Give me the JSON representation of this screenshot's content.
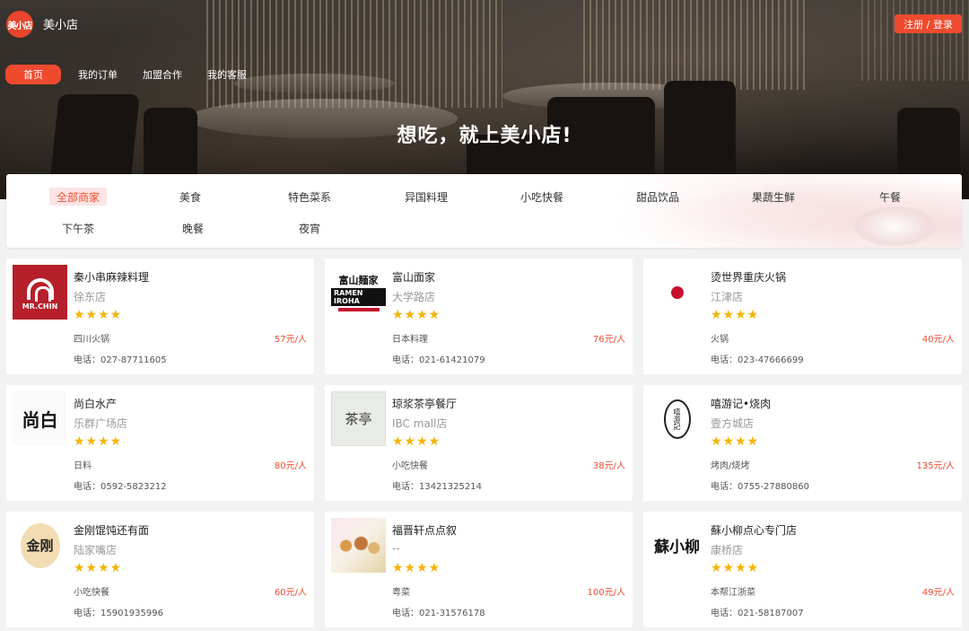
{
  "header": {
    "logo_text": "美小店",
    "brand": "美小店",
    "auth_label": "注册 / 登录",
    "nav": [
      "首页",
      "我的订单",
      "加盟合作",
      "我的客服"
    ],
    "slogan": "想吃，就上美小店!"
  },
  "categories": {
    "items": [
      "全部商家",
      "美食",
      "特色菜系",
      "异国料理",
      "小吃快餐",
      "甜品饮品",
      "果蔬生鲜",
      "午餐",
      "下午茶",
      "晚餐",
      "夜宵"
    ],
    "active": "全部商家"
  },
  "stores": [
    {
      "name": "秦小串麻辣料理",
      "branch": "徐东店",
      "stars": "★★★★",
      "category": "四川火锅",
      "price": "57元/人",
      "phone": "电话：027-87711605",
      "thumb_text": "MR.CHIN"
    },
    {
      "name": "富山面家",
      "branch": "大学路店",
      "stars": "★★★★",
      "category": "日本料理",
      "price": "76元/人",
      "phone": "电话：021-61421079",
      "thumb_text": "富山麺家",
      "thumb_text2": "RAMEN IROHA"
    },
    {
      "name": "烫世界重庆火锅",
      "branch": "江津店",
      "stars": "★★★★",
      "category": "火锅",
      "price": "40元/人",
      "phone": "电话：023-47666699"
    },
    {
      "name": "尚白水产",
      "branch": "乐群广场店",
      "stars": "★★★★",
      "category": "日料",
      "price": "80元/人",
      "phone": "电话：0592-5823212",
      "thumb_text": "尚白"
    },
    {
      "name": "琼浆茶亭餐厅",
      "branch": "IBC mall店",
      "stars": "★★★★",
      "category": "小吃快餐",
      "price": "38元/人",
      "phone": "电话：13421325214",
      "thumb_text": "茶亭"
    },
    {
      "name": "嘻游记•烧肉",
      "branch": "壹方城店",
      "stars": "★★★★",
      "category": "烤肉/烧烤",
      "price": "135元/人",
      "phone": "电话：0755-27880860",
      "thumb_text": "嘻游記"
    },
    {
      "name": "金刚馄饨还有面",
      "branch": "陆家嘴店",
      "stars": "★★★★",
      "category": "小吃快餐",
      "price": "60元/人",
      "phone": "电话：15901935996",
      "thumb_text": "金刚"
    },
    {
      "name": "福晋轩点点叙",
      "branch": "--",
      "stars": "★★★★",
      "category": "粤菜",
      "price": "100元/人",
      "phone": "电话：021-31576178"
    },
    {
      "name": "蘇小柳点心专门店",
      "branch": "康桥店",
      "stars": "★★★★",
      "category": "本帮江浙菜",
      "price": "49元/人",
      "phone": "电话：021-58187007",
      "thumb_text": "蘇小柳"
    }
  ],
  "colors": {
    "accent": "#f04a2e",
    "star": "#f5b301",
    "active_bg": "#fde4e4"
  }
}
